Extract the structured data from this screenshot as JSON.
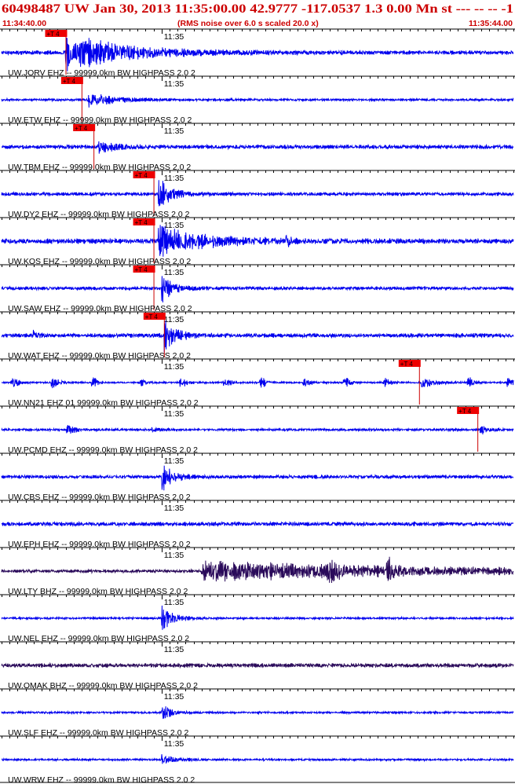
{
  "header": {
    "title": "60498487 UW Jan 30, 2013 11:35:00.00   42.9777 -117.0537  1.3 0.00 Mn st --- -- --   -1",
    "start_time": "11:34:40.00",
    "subtitle": "(RMS noise over 6.0 s scaled 20.0 x)",
    "end_time": "11:35:44.00"
  },
  "colors": {
    "text_red": "#cc0000",
    "trace_blue": "#0000ee",
    "trace_purple": "#2a0a5a",
    "pick_fill": "#ee0000",
    "pick_line": "#cc0000",
    "grid": "#000000",
    "background": "#ffffff"
  },
  "chart_data": {
    "type": "seismogram",
    "x_range_seconds": [
      0,
      64
    ],
    "minute_mark_label": "11:35",
    "minute_mark_seconds": 20,
    "tick_interval_seconds": 1,
    "pick_label": "+T 4",
    "traces": [
      {
        "label": "UW.JORV EHZ -- 99999.0km BW  HIGHPASS  2.0  2",
        "color": "blue",
        "pick_seconds": 8.0,
        "event_seconds": 8.0,
        "event_amp": 1.0,
        "event_decay": 7.0,
        "noise": 0.12,
        "extra_events": []
      },
      {
        "label": "UW.ETW EHZ -- 99999.0km BW  HIGHPASS  2.0  2",
        "color": "blue",
        "pick_seconds": 10.0,
        "event_seconds": 10.8,
        "event_amp": 0.45,
        "event_decay": 3.0,
        "noise": 0.07,
        "extra_events": []
      },
      {
        "label": "UW.TBM EHZ -- 99999.0km BW  HIGHPASS  2.0  2",
        "color": "blue",
        "pick_seconds": 11.5,
        "event_seconds": 12.0,
        "event_amp": 0.35,
        "event_decay": 2.0,
        "noise": 0.12,
        "extra_events": []
      },
      {
        "label": "UW.DY2 EHZ -- 99999.0km BW  HIGHPASS  2.0  2",
        "color": "blue",
        "pick_seconds": 19.0,
        "event_seconds": 19.6,
        "event_amp": 1.0,
        "event_decay": 1.5,
        "noise": 0.1,
        "extra_events": []
      },
      {
        "label": "UW.KOS EHZ -- 99999.0km BW  HIGHPASS  2.0  2",
        "color": "blue",
        "pick_seconds": 19.0,
        "event_seconds": 19.6,
        "event_amp": 0.9,
        "event_decay": 5.0,
        "noise": 0.15,
        "extra_events": [
          {
            "seconds": 35.7,
            "amp": 0.6,
            "decay": 0.3
          }
        ]
      },
      {
        "label": "UW.SAW EHZ -- 99999.0km BW  HIGHPASS  2.0  2",
        "color": "blue",
        "pick_seconds": 19.0,
        "event_seconds": 20.0,
        "event_amp": 1.0,
        "event_decay": 1.2,
        "noise": 0.1,
        "extra_events": []
      },
      {
        "label": "UW.WAT EHZ -- 99999.0km BW  HIGHPASS  2.0  2",
        "color": "blue",
        "pick_seconds": 20.3,
        "event_seconds": 20.3,
        "event_amp": 0.9,
        "event_decay": 1.5,
        "noise": 0.12,
        "extra_events": [
          {
            "seconds": 4.0,
            "amp": 0.25,
            "decay": 0.4
          }
        ]
      },
      {
        "label": "UW.NN21 EHZ 01 99999.0km BW  HIGHPASS  2.0  2",
        "color": "blue",
        "pick_seconds": 52.2,
        "event_seconds": 52.5,
        "event_amp": 0.35,
        "event_decay": 1.5,
        "noise": 0.05,
        "extra_events": [
          {
            "seconds": 1.5,
            "amp": 0.3,
            "decay": 0.6
          },
          {
            "seconds": 6.5,
            "amp": 0.35,
            "decay": 0.6
          },
          {
            "seconds": 11.5,
            "amp": 0.3,
            "decay": 0.6
          },
          {
            "seconds": 17.5,
            "amp": 0.25,
            "decay": 0.5
          },
          {
            "seconds": 22.5,
            "amp": 0.3,
            "decay": 0.6
          },
          {
            "seconds": 28.0,
            "amp": 0.3,
            "decay": 0.6
          },
          {
            "seconds": 32.5,
            "amp": 0.35,
            "decay": 0.6
          },
          {
            "seconds": 38.0,
            "amp": 0.3,
            "decay": 0.6
          },
          {
            "seconds": 43.0,
            "amp": 0.3,
            "decay": 0.6
          },
          {
            "seconds": 48.0,
            "amp": 0.3,
            "decay": 0.6
          },
          {
            "seconds": 58.5,
            "amp": 0.3,
            "decay": 0.6
          },
          {
            "seconds": 63.5,
            "amp": 0.3,
            "decay": 0.6
          }
        ]
      },
      {
        "label": "UW.PCMD EHZ -- 99999.0km BW  HIGHPASS  2.0  2",
        "color": "blue",
        "pick_seconds": 59.5,
        "event_seconds": 59.8,
        "event_amp": 0.3,
        "event_decay": 0.8,
        "noise": 0.07,
        "extra_events": [
          {
            "seconds": 8.5,
            "amp": 0.25,
            "decay": 0.8
          },
          {
            "seconds": 19.0,
            "amp": 0.15,
            "decay": 0.5
          }
        ]
      },
      {
        "label": "UW.CBS EHZ -- 99999.0km BW  HIGHPASS  2.0  2",
        "color": "blue",
        "pick_seconds": null,
        "event_seconds": 20.0,
        "event_amp": 1.0,
        "event_decay": 1.2,
        "noise": 0.1,
        "extra_events": []
      },
      {
        "label": "UW.EPH EHZ -- 99999.0km BW  HIGHPASS  2.0  2",
        "color": "blue",
        "pick_seconds": null,
        "event_seconds": null,
        "event_amp": 0,
        "event_decay": 1,
        "noise": 0.12,
        "extra_events": []
      },
      {
        "label": "UW.LTY BHZ -- 99999.0km BW  HIGHPASS  2.0  2",
        "color": "purple",
        "pick_seconds": null,
        "event_seconds": 25.0,
        "event_amp": 0.55,
        "event_decay": 28.0,
        "noise": 0.09,
        "extra_events": [
          {
            "seconds": 41.0,
            "amp": 0.55,
            "decay": 0.8
          },
          {
            "seconds": 48.5,
            "amp": 0.5,
            "decay": 0.8
          }
        ]
      },
      {
        "label": "UW.NEL EHZ -- 99999.0km BW  HIGHPASS  2.0  2",
        "color": "blue",
        "pick_seconds": null,
        "event_seconds": 20.0,
        "event_amp": 0.7,
        "event_decay": 1.5,
        "noise": 0.06,
        "extra_events": []
      },
      {
        "label": "UW.OMAK BHZ -- 99999.0km BW  HIGHPASS  2.0  2",
        "color": "purple",
        "pick_seconds": null,
        "event_seconds": null,
        "event_amp": 0,
        "event_decay": 1,
        "noise": 0.12,
        "extra_events": []
      },
      {
        "label": "UW.SLF EHZ -- 99999.0km BW  HIGHPASS  2.0  2",
        "color": "blue",
        "pick_seconds": null,
        "event_seconds": 20.0,
        "event_amp": 0.6,
        "event_decay": 1.0,
        "noise": 0.06,
        "extra_events": []
      },
      {
        "label": "UW.WRW EHZ -- 99999.0km BW  HIGHPASS  2.0  2",
        "color": "blue",
        "pick_seconds": null,
        "event_seconds": 20.0,
        "event_amp": 0.3,
        "event_decay": 1.5,
        "noise": 0.06,
        "extra_events": []
      }
    ]
  }
}
